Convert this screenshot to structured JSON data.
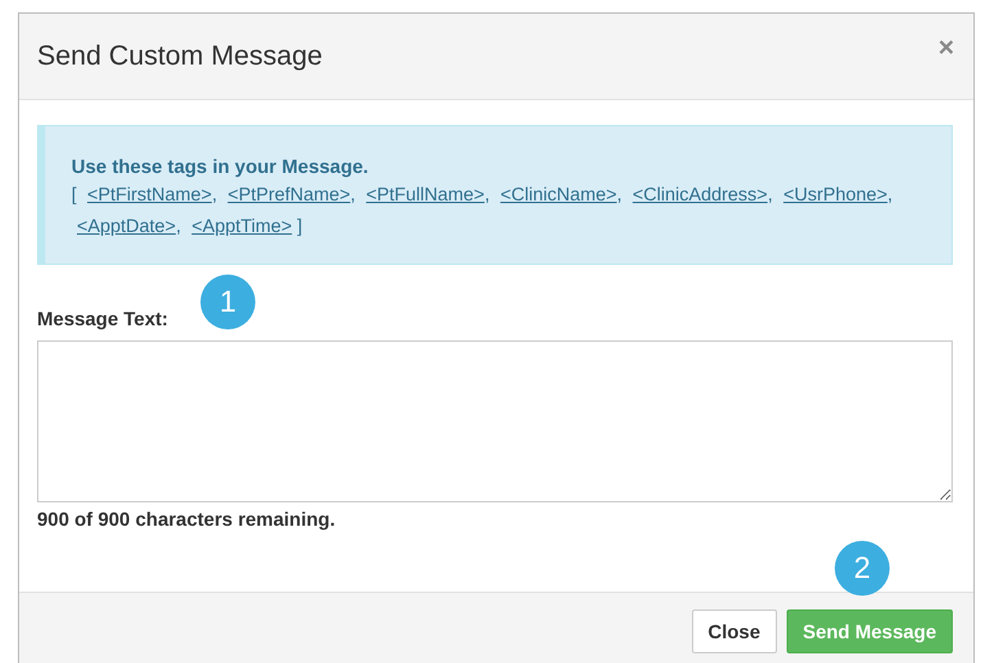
{
  "dialog": {
    "title": "Send Custom Message",
    "close_icon": "×"
  },
  "info": {
    "heading": "Use these tags in your Message.",
    "open": "[",
    "close": "]",
    "separator": ",",
    "tags": [
      "<PtFirstName>",
      "<PtPrefName>",
      "<PtFullName>",
      "<ClinicName>",
      "<ClinicAddress>",
      "<UsrPhone>",
      "<ApptDate>",
      "<ApptTime>"
    ]
  },
  "message": {
    "label": "Message Text:",
    "remaining": "900 of 900 characters remaining."
  },
  "buttons": [
    {
      "label": "Close",
      "kind": "default"
    },
    {
      "label": "Send Message",
      "kind": "primary"
    }
  ],
  "callouts": [
    "1",
    "2"
  ]
}
